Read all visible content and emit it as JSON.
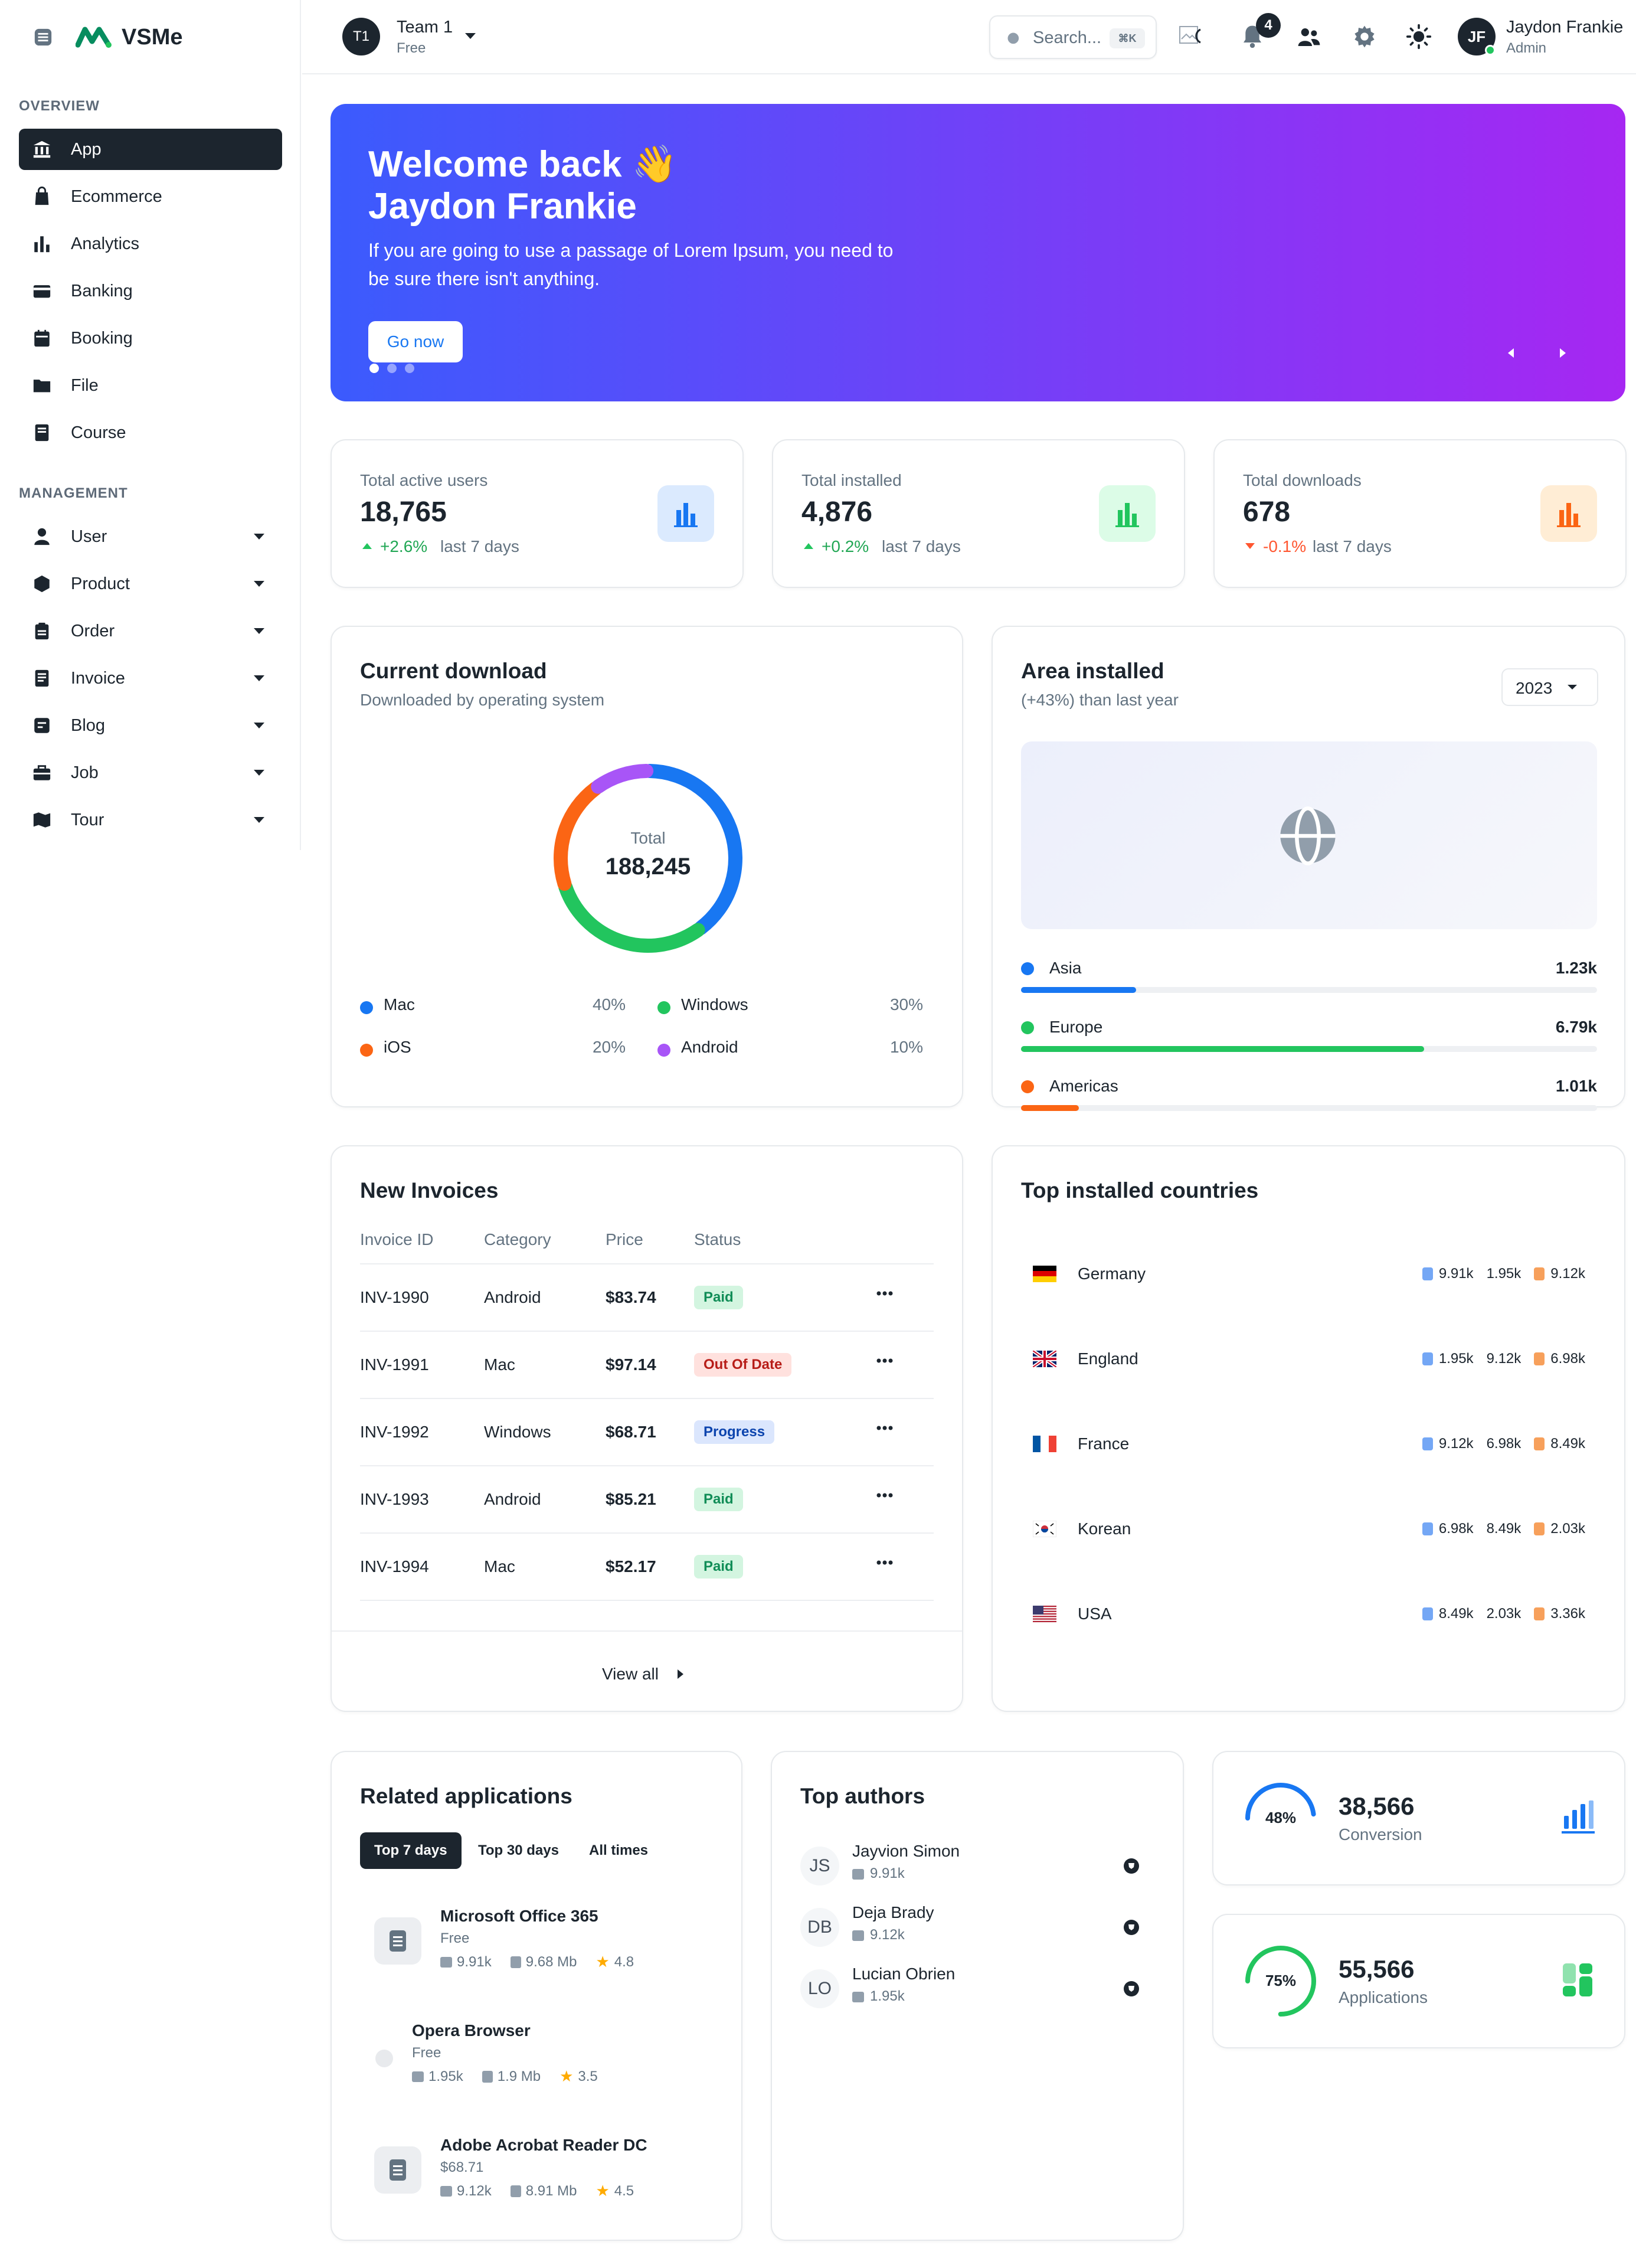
{
  "brand": {
    "name": "VSMe"
  },
  "colors": {
    "primary": "#1877f2",
    "green": "#22c55e",
    "orange": "#fb6514",
    "purple": "#a855f7",
    "dark": "#1c252e"
  },
  "sidebar": {
    "overview_title": "OVERVIEW",
    "overview_items": [
      {
        "label": "App",
        "icon": "bank-icon",
        "active": true
      },
      {
        "label": "Ecommerce",
        "icon": "bag-icon"
      },
      {
        "label": "Analytics",
        "icon": "bar-chart-icon"
      },
      {
        "label": "Banking",
        "icon": "card-icon"
      },
      {
        "label": "Booking",
        "icon": "calendar-icon"
      },
      {
        "label": "File",
        "icon": "folder-icon"
      },
      {
        "label": "Course",
        "icon": "book-icon"
      }
    ],
    "management_title": "MANAGEMENT",
    "management_items": [
      {
        "label": "User",
        "icon": "user-icon"
      },
      {
        "label": "Product",
        "icon": "box-icon"
      },
      {
        "label": "Order",
        "icon": "clipboard-icon"
      },
      {
        "label": "Invoice",
        "icon": "invoice-icon"
      },
      {
        "label": "Blog",
        "icon": "blog-icon"
      },
      {
        "label": "Job",
        "icon": "briefcase-icon"
      },
      {
        "label": "Tour",
        "icon": "map-icon"
      }
    ]
  },
  "header": {
    "team": {
      "avatar": "T1",
      "name": "Team 1",
      "plan": "Free"
    },
    "search": {
      "placeholder": "Search...",
      "shortcut": "⌘K"
    },
    "notifications": {
      "count": "4"
    },
    "user": {
      "initials": "JF",
      "name": "Jaydon Frankie",
      "role": "Admin"
    }
  },
  "banner": {
    "title_line1": "Welcome back 👋",
    "title_line2": "Jaydon Frankie",
    "text": "If you are going to use a passage of Lorem Ipsum, you need to be sure there isn't anything.",
    "button": "Go now",
    "colors": [
      "#3b5bfd",
      "#a627f2"
    ]
  },
  "stats": [
    {
      "label": "Total active users",
      "value": "18,765",
      "change": "+2.6%",
      "period": "last 7 days",
      "trend": "up",
      "icon_color": "#1877f2",
      "icon_bg": "#dbeafe"
    },
    {
      "label": "Total installed",
      "value": "4,876",
      "change": "+0.2%",
      "period": "last 7 days",
      "trend": "up",
      "icon_color": "#22c55e",
      "icon_bg": "#dcfce7"
    },
    {
      "label": "Total downloads",
      "value": "678",
      "change": "-0.1%",
      "period": "last 7 days",
      "trend": "down",
      "icon_color": "#fb6514",
      "icon_bg": "#ffedd5"
    }
  ],
  "current_download": {
    "title": "Current download",
    "subtitle": "Downloaded by operating system",
    "total_label": "Total",
    "total_value": "188,245",
    "legend": [
      {
        "label": "Mac",
        "percent": "40%",
        "color": "#1877f2"
      },
      {
        "label": "Windows",
        "percent": "30%",
        "color": "#22c55e"
      },
      {
        "label": "iOS",
        "percent": "20%",
        "color": "#fb6514"
      },
      {
        "label": "Android",
        "percent": "10%",
        "color": "#a855f7"
      }
    ]
  },
  "chart_data": {
    "type": "pie",
    "categories": [
      "Mac",
      "Windows",
      "iOS",
      "Android"
    ],
    "values": [
      40,
      30,
      20,
      10
    ],
    "title": "Current download"
  },
  "area_installed": {
    "title": "Area installed",
    "subtitle": "(+43%) than last year",
    "year": "2023",
    "regions": [
      {
        "label": "Asia",
        "value": "1.23k",
        "fraction": 0.2,
        "color": "#1877f2"
      },
      {
        "label": "Europe",
        "value": "6.79k",
        "fraction": 0.7,
        "color": "#22c55e"
      },
      {
        "label": "Americas",
        "value": "1.01k",
        "fraction": 0.1,
        "color": "#fb6514"
      }
    ]
  },
  "invoices": {
    "title": "New Invoices",
    "columns": [
      "Invoice ID",
      "Category",
      "Price",
      "Status"
    ],
    "rows": [
      {
        "id": "INV-1990",
        "category": "Android",
        "price": "$83.74",
        "status": "Paid",
        "fg": "#118d57",
        "bg": "#d3f5e0"
      },
      {
        "id": "INV-1991",
        "category": "Mac",
        "price": "$97.14",
        "status": "Out Of Date",
        "fg": "#b71d18",
        "bg": "#ffe1de"
      },
      {
        "id": "INV-1992",
        "category": "Windows",
        "price": "$68.71",
        "status": "Progress",
        "fg": "#0c44ae",
        "bg": "#dbe6fd"
      },
      {
        "id": "INV-1993",
        "category": "Android",
        "price": "$85.21",
        "status": "Paid",
        "fg": "#118d57",
        "bg": "#d3f5e0"
      },
      {
        "id": "INV-1994",
        "category": "Mac",
        "price": "$52.17",
        "status": "Paid",
        "fg": "#118d57",
        "bg": "#d3f5e0"
      }
    ],
    "view_all": "View all"
  },
  "countries": {
    "title": "Top installed countries",
    "rows": [
      {
        "name": "Germany",
        "flag": "de",
        "android": "9.91k",
        "windows": "1.95k",
        "ios": "9.12k"
      },
      {
        "name": "England",
        "flag": "gb",
        "android": "1.95k",
        "windows": "9.12k",
        "ios": "6.98k"
      },
      {
        "name": "France",
        "flag": "fr",
        "android": "9.12k",
        "windows": "6.98k",
        "ios": "8.49k"
      },
      {
        "name": "Korean",
        "flag": "kr",
        "android": "6.98k",
        "windows": "8.49k",
        "ios": "2.03k"
      },
      {
        "name": "USA",
        "flag": "us",
        "android": "8.49k",
        "windows": "2.03k",
        "ios": "3.36k"
      }
    ]
  },
  "related_apps": {
    "title": "Related applications",
    "tabs": [
      "Top 7 days",
      "Top 30 days",
      "All times"
    ],
    "apps": [
      {
        "name": "Microsoft Office 365",
        "price": "Free",
        "downloads": "9.91k",
        "size": "9.68 Mb",
        "rating": "4.8",
        "has_icon": true
      },
      {
        "name": "Opera Browser",
        "price": "Free",
        "downloads": "1.95k",
        "size": "1.9 Mb",
        "rating": "3.5",
        "has_icon": false
      },
      {
        "name": "Adobe Acrobat Reader DC",
        "price": "$68.71",
        "downloads": "9.12k",
        "size": "8.91 Mb",
        "rating": "4.5",
        "has_icon": true
      }
    ]
  },
  "top_authors": {
    "title": "Top authors",
    "authors": [
      {
        "initials": "JS",
        "name": "Jayvion Simon",
        "likes": "9.91k"
      },
      {
        "initials": "DB",
        "name": "Deja Brady",
        "likes": "9.12k"
      },
      {
        "initials": "LO",
        "name": "Lucian Obrien",
        "likes": "1.95k"
      }
    ]
  },
  "widgets": [
    {
      "percent": "48%",
      "fraction": 0.48,
      "value": "38,566",
      "label": "Conversion",
      "color": "#1877f2"
    },
    {
      "percent": "75%",
      "fraction": 0.75,
      "value": "55,566",
      "label": "Applications",
      "color": "#22c55e"
    }
  ]
}
